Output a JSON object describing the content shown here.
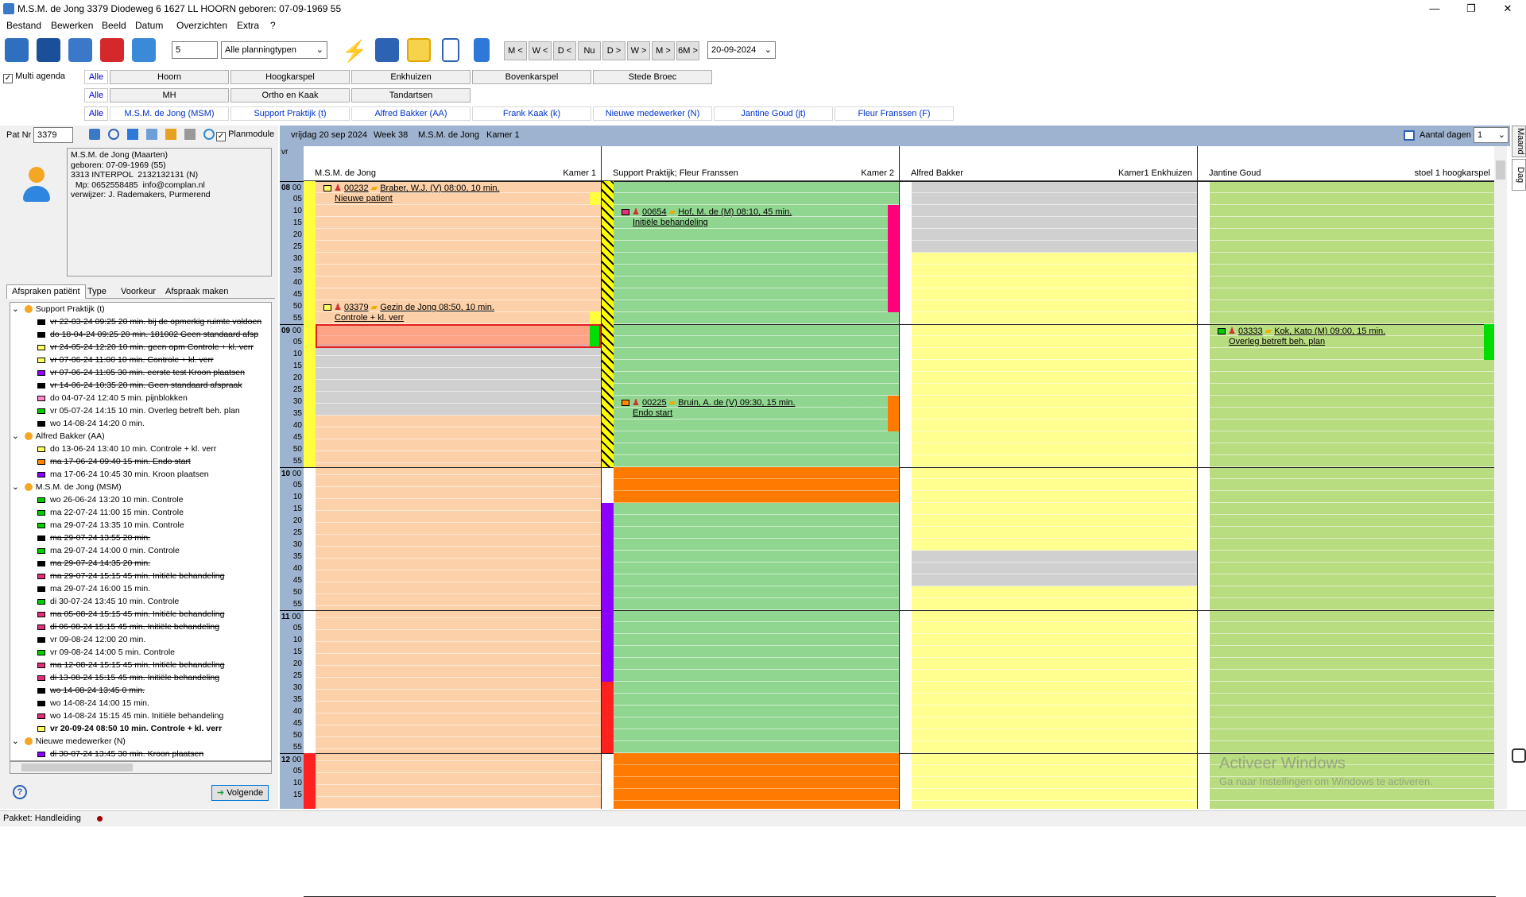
{
  "window": {
    "title": "M.S.M. de Jong 3379 Diodeweg 6 1627 LL HOORN geboren: 07-09-1969 55",
    "min": "—",
    "max": "❐",
    "close": "✕"
  },
  "menu": [
    "Bestand",
    "Bewerken",
    "Beeld",
    "Datum",
    "Overzichten",
    "Extra",
    "?"
  ],
  "toolbar": {
    "count": "5",
    "planningtype": "Alle planningtypen",
    "nav": [
      "M <",
      "W <",
      "D <",
      "Nu",
      "D >",
      "W >",
      "M >",
      "6M >"
    ],
    "date": "20-09-2024"
  },
  "multi_agenda": "Multi agenda",
  "locations": {
    "alle": "Alle",
    "items": [
      "Hoorn",
      "Hoogkarspel",
      "Enkhuizen",
      "Bovenkarspel",
      "Stede Broec"
    ]
  },
  "groups": {
    "alle": "Alle",
    "items": [
      "MH",
      "Ortho en Kaak",
      "Tandartsen"
    ]
  },
  "persons": {
    "alle": "Alle",
    "items": [
      "M.S.M. de Jong (MSM)",
      "Support Praktijk (t)",
      "Alfred Bakker (AA)",
      "Frank Kaak (k)",
      "Nieuwe medewerker (N)",
      "Jantine Goud (jt)",
      "Fleur Franssen (F)"
    ]
  },
  "patient": {
    "label": "Pat Nr",
    "nr": "3379",
    "planmodule": "Planmodule",
    "info": [
      "M.S.M. de Jong (Maarten)",
      "geboren: 07-09-1969 (55)",
      "3313 INTERPOL  2132132131 (N)",
      "  Mp: 0652558485  info@complan.nl",
      "verwijzer: J. Rademakers, Purmerend"
    ]
  },
  "tabs": [
    "Afspraken patiënt",
    "Type",
    "Voorkeur",
    "Afspraak maken"
  ],
  "tree": [
    {
      "t": "g",
      "label": "Support Praktijk (t)"
    },
    {
      "t": "i",
      "c": "#000000",
      "s": 1,
      "label": "vr 22-03-24 09:25 20 min. bij de opmerkig ruimte voldoen"
    },
    {
      "t": "i",
      "c": "#000000",
      "s": 1,
      "label": "do 18-04-24 09:25 20 min. 181002 Geen standaard afsp"
    },
    {
      "t": "i",
      "c": "#ffff66",
      "s": 1,
      "label": "vr 24-05-24 12:20 10 min. geen opm Controle + kl. verr"
    },
    {
      "t": "i",
      "c": "#ffff66",
      "s": 1,
      "label": "vr 07-06-24 11:00 10 min. Controle + kl. verr"
    },
    {
      "t": "i",
      "c": "#8b00ff",
      "s": 1,
      "label": "vr 07-06-24 11:05 30 min. eerste test Kroon plaatsen"
    },
    {
      "t": "i",
      "c": "#000000",
      "s": 1,
      "label": "vr 14-06-24 10:35 20 min. Geen standaard afspraak"
    },
    {
      "t": "i",
      "c": "#ff88cc",
      "s": 0,
      "label": "do 04-07-24 12:40 5 min. pijnblokken"
    },
    {
      "t": "i",
      "c": "#00cc00",
      "s": 0,
      "label": "vr 05-07-24 14:15 10 min. Overleg betreft beh. plan"
    },
    {
      "t": "i",
      "c": "#000000",
      "s": 0,
      "label": "wo 14-08-24 14:20 0 min."
    },
    {
      "t": "g",
      "label": "Alfred Bakker (AA)"
    },
    {
      "t": "i",
      "c": "#ffff66",
      "s": 0,
      "label": "do 13-06-24 13:40 10 min. Controle + kl. verr"
    },
    {
      "t": "i",
      "c": "#ff8800",
      "s": 1,
      "label": "ma 17-06-24 09:40 15 min. Endo start"
    },
    {
      "t": "i",
      "c": "#8b00ff",
      "s": 0,
      "label": "ma 17-06-24 10:45 30 min. Kroon plaatsen"
    },
    {
      "t": "g",
      "label": "M.S.M. de Jong (MSM)"
    },
    {
      "t": "i",
      "c": "#00cc00",
      "s": 0,
      "label": "wo 26-06-24 13:20 10 min. Controle"
    },
    {
      "t": "i",
      "c": "#00cc00",
      "s": 0,
      "label": "ma 22-07-24 11:00 15 min. Controle"
    },
    {
      "t": "i",
      "c": "#00cc00",
      "s": 0,
      "label": "ma 29-07-24 13:35 10 min. Controle"
    },
    {
      "t": "i",
      "c": "#000000",
      "s": 1,
      "label": "ma 29-07-24 13:55 20 min."
    },
    {
      "t": "i",
      "c": "#00cc00",
      "s": 0,
      "label": "ma 29-07-24 14:00 0 min. Controle"
    },
    {
      "t": "i",
      "c": "#000000",
      "s": 1,
      "label": "ma 29-07-24 14:35 20 min."
    },
    {
      "t": "i",
      "c": "#e0307a",
      "s": 1,
      "label": "ma 29-07-24 15:15 45 min. Initiële behandeling"
    },
    {
      "t": "i",
      "c": "#000000",
      "s": 0,
      "label": "ma 29-07-24 16:00 15 min."
    },
    {
      "t": "i",
      "c": "#00cc00",
      "s": 0,
      "label": "di 30-07-24 13:45 10 min. Controle"
    },
    {
      "t": "i",
      "c": "#e0307a",
      "s": 1,
      "label": "ma 05-08-24 15:15 45 min. Initiële behandeling"
    },
    {
      "t": "i",
      "c": "#e0307a",
      "s": 1,
      "label": "di 06-08-24 15:15 45 min. Initiële behandeling"
    },
    {
      "t": "i",
      "c": "#000000",
      "s": 0,
      "label": "vr 09-08-24 12:00 20 min."
    },
    {
      "t": "i",
      "c": "#00cc00",
      "s": 0,
      "label": "vr 09-08-24 14:00 5 min. Controle"
    },
    {
      "t": "i",
      "c": "#e0307a",
      "s": 1,
      "label": "ma 12-08-24 15:15 45 min. Initiële behandeling"
    },
    {
      "t": "i",
      "c": "#e0307a",
      "s": 1,
      "label": "di 13-08-24 15:15 45 min. Initiële behandeling"
    },
    {
      "t": "i",
      "c": "#000000",
      "s": 1,
      "label": "wo 14-08-24 13:45 0 min."
    },
    {
      "t": "i",
      "c": "#000000",
      "s": 0,
      "label": "wo 14-08-24 14:00 15 min."
    },
    {
      "t": "i",
      "c": "#e0307a",
      "s": 0,
      "label": "wo 14-08-24 15:15 45 min. Initiële behandeling"
    },
    {
      "t": "i",
      "c": "#ffff66",
      "s": 0,
      "b": 1,
      "label": "vr 20-09-24 08:50 10 min. Controle + kl. verr"
    },
    {
      "t": "g",
      "label": "Nieuwe medewerker (N)"
    },
    {
      "t": "i",
      "c": "#8b00ff",
      "s": 1,
      "label": "di 30-07-24 13:45 30 min. Kroon plaatsen"
    }
  ],
  "next_button": "Volgende",
  "agenda": {
    "header": [
      "vrijdag 20 sep 2024",
      "Week 38",
      "M.S.M. de Jong",
      "Kamer 1"
    ],
    "days_label": "Aantal dagen",
    "days": "1",
    "side_tabs": [
      "Maand",
      "Dag"
    ],
    "dow": "vr",
    "columns": [
      {
        "name": "M.S.M. de Jong",
        "room": "Kamer 1"
      },
      {
        "name": "Support Praktijk; Fleur Franssen",
        "room": "Kamer 2"
      },
      {
        "name": "Alfred Bakker",
        "room": "Kamer1 Enkhuizen"
      },
      {
        "name": "Jantine Goud",
        "room": "stoel 1 hoogkarspel"
      }
    ],
    "hours": [
      "08",
      "09",
      "10",
      "11",
      "12"
    ],
    "minutes": [
      "00",
      "05",
      "10",
      "15",
      "20",
      "25",
      "30",
      "35",
      "40",
      "45",
      "50",
      "55"
    ],
    "appointments": [
      {
        "col": 0,
        "num": "00232",
        "who": "Braber, W.J. (V) 08:00, 10 min.",
        "desc": "Nieuwe patient"
      },
      {
        "col": 0,
        "num": "03379",
        "who": "Gezin de Jong 08:50, 10 min.",
        "desc": "Controle + kl. verr"
      },
      {
        "col": 1,
        "num": "00654",
        "who": "Hof, M. de (M) 08:10, 45 min.",
        "desc": "Initiële behandeling"
      },
      {
        "col": 1,
        "num": "00225",
        "who": "Bruin, A. de (V) 09:30, 15 min.",
        "desc": "Endo start"
      },
      {
        "col": 3,
        "num": "03333",
        "who": "Kok, Kato (M) 09:00, 15 min.",
        "desc": "Overleg betreft beh. plan"
      }
    ]
  },
  "watermark": {
    "title": "Activeer Windows",
    "sub": "Ga naar Instellingen om Windows te activeren."
  },
  "status": "Pakket: Handleiding"
}
